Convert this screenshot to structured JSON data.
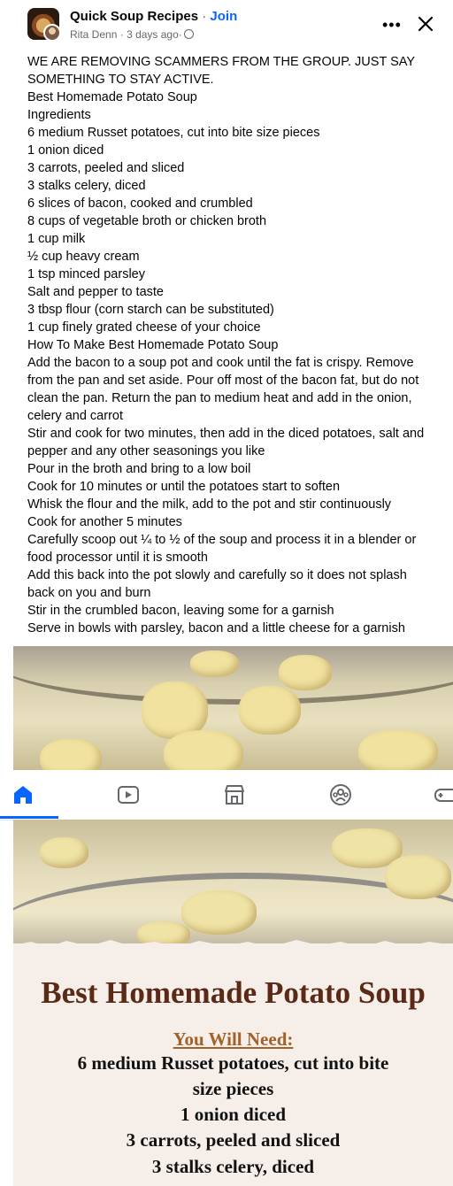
{
  "post": {
    "group_name": "Quick Soup Recipes",
    "separator": "·",
    "join_label": "Join",
    "author": "Rita Denn",
    "time": "3 days ago",
    "privacy_icon": "globe-icon",
    "more_icon": "more-icon",
    "close_icon": "close-icon",
    "body_lines": [
      "WE ARE REMOVING SCAMMERS FROM THE GROUP. JUST SAY",
      "SOMETHING TO STAY ACTIVE.",
      "Best Homemade Potato Soup",
      "Ingredients",
      "6 medium Russet potatoes, cut into bite size pieces",
      "1 onion diced",
      "3 carrots, peeled and sliced",
      "3 stalks celery, diced",
      "6 slices of bacon, cooked and crumbled",
      "8 cups of vegetable broth or chicken broth",
      "1 cup milk",
      "½ cup heavy cream",
      "1 tsp minced parsley",
      "Salt and pepper to taste",
      "3 tbsp flour (corn starch can be substituted)",
      "1 cup finely grated cheese of your choice",
      "How To Make Best Homemade Potato Soup",
      "Add the bacon to a soup pot and cook until the fat is crispy. Remove",
      "from the pan and set aside. Pour off most of the bacon fat, but do not",
      "clean the pan. Return the pan to medium heat and add in the onion,",
      "celery and carrot",
      "Stir and cook for two minutes, then add in the diced potatoes, salt and",
      "pepper and any other seasonings you like",
      "Pour in the broth and bring to a low boil",
      "Cook for 10 minutes or until the potatoes start to soften",
      "Whisk the flour and the milk, add to the pot and stir continuously",
      "Cook for another 5 minutes",
      "Carefully scoop out ¼ to ½ of the soup and process it in a blender or",
      "food processor until it is smooth",
      "Add this back into the pot slowly and carefully so it does not splash",
      "back on you and burn",
      "Stir in the crumbled bacon, leaving some for a garnish",
      "Serve in bowls with parsley, bacon and a little cheese for a garnish"
    ]
  },
  "bottom_nav": {
    "items": [
      {
        "icon": "home-icon",
        "active": true
      },
      {
        "icon": "video-icon",
        "active": false
      },
      {
        "icon": "marketplace-icon",
        "active": false
      },
      {
        "icon": "groups-icon",
        "active": false
      },
      {
        "icon": "gaming-icon",
        "active": false
      }
    ],
    "accent_color": "#0866ff"
  },
  "recipe_image": {
    "title": "Best Homemade Potato Soup",
    "heading": "You Will Need:",
    "lines": [
      "6 medium Russet potatoes, cut into bite",
      "size pieces",
      "1 onion diced",
      "3 carrots, peeled and sliced",
      "3 stalks celery, diced"
    ],
    "title_color": "#5b2a16",
    "heading_color": "#a2622a"
  }
}
